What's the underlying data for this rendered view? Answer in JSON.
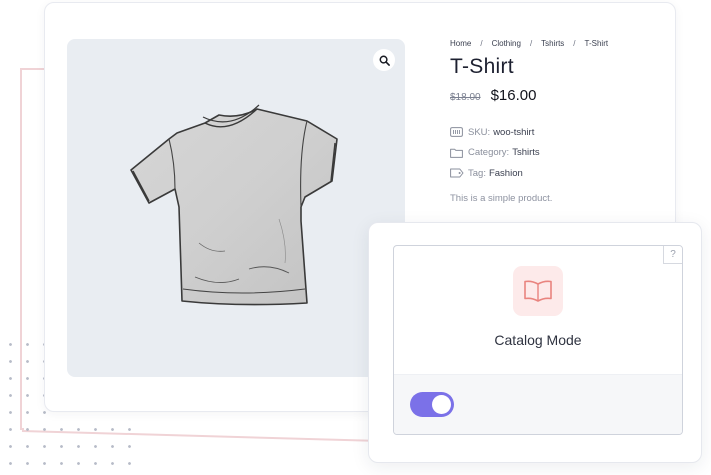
{
  "breadcrumb": [
    "Home",
    "Clothing",
    "Tshirts",
    "T-Shirt"
  ],
  "product": {
    "title": "T-Shirt",
    "price_old": "$18.00",
    "price_new": "$16.00",
    "sku_label": "SKU:",
    "sku_value": "woo-tshirt",
    "category_label": "Category:",
    "category_value": "Tshirts",
    "tag_label": "Tag:",
    "tag_value": "Fashion",
    "short_description": "This is a simple product."
  },
  "widget": {
    "title": "Catalog Mode",
    "help_label": "?",
    "toggle_enabled": true
  },
  "colors": {
    "accent_toggle": "#7b71e8",
    "icon_bg": "#fdeaea",
    "icon_stroke": "#e9847f"
  },
  "icons": [
    "search-icon",
    "barcode-icon",
    "folder-icon",
    "tag-icon",
    "book-open-icon",
    "help-icon"
  ]
}
